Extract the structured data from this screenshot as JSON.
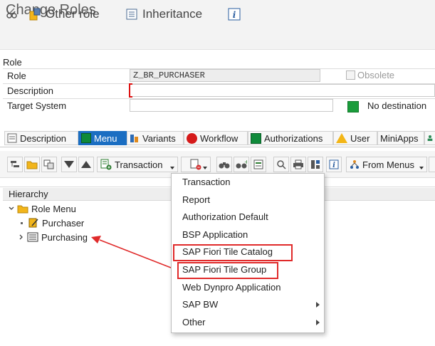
{
  "title": "Change Roles",
  "toolbar": {
    "other_role": "Other role",
    "inheritance": "Inheritance"
  },
  "role_section": {
    "title": "Role",
    "fields": {
      "role_label": "Role",
      "role_value": "Z_BR_PURCHASER",
      "obsolete_label": "Obsolete",
      "description_label": "Description",
      "description_value": "",
      "target_system_label": "Target System",
      "target_system_value": "",
      "no_destination_label": "No destination"
    }
  },
  "tabs": [
    {
      "label": "Description"
    },
    {
      "label": "Menu"
    },
    {
      "label": "Variants"
    },
    {
      "label": "Workflow"
    },
    {
      "label": "Authorizations"
    },
    {
      "label": "User"
    },
    {
      "label": "MiniApps"
    }
  ],
  "menu_toolbar": {
    "transaction_label": "Transaction",
    "from_menus_label": "From Menus"
  },
  "hierarchy": {
    "title": "Hierarchy",
    "tree": [
      {
        "label": "Role Menu"
      },
      {
        "label": "Purchaser"
      },
      {
        "label": "Purchasing"
      }
    ]
  },
  "dropdown_menu": {
    "items": [
      {
        "label": "Transaction"
      },
      {
        "label": "Report"
      },
      {
        "label": "Authorization Default"
      },
      {
        "label": "BSP Application"
      },
      {
        "label": "SAP Fiori Tile Catalog"
      },
      {
        "label": "SAP Fiori Tile Group"
      },
      {
        "label": "Web Dynpro Application"
      },
      {
        "label": "SAP BW"
      },
      {
        "label": "Other"
      }
    ]
  },
  "colors": {
    "tab_active_bg": "#1b6ec2",
    "annotation_red": "#e02a2a",
    "green_status": "#1a9c3b"
  }
}
